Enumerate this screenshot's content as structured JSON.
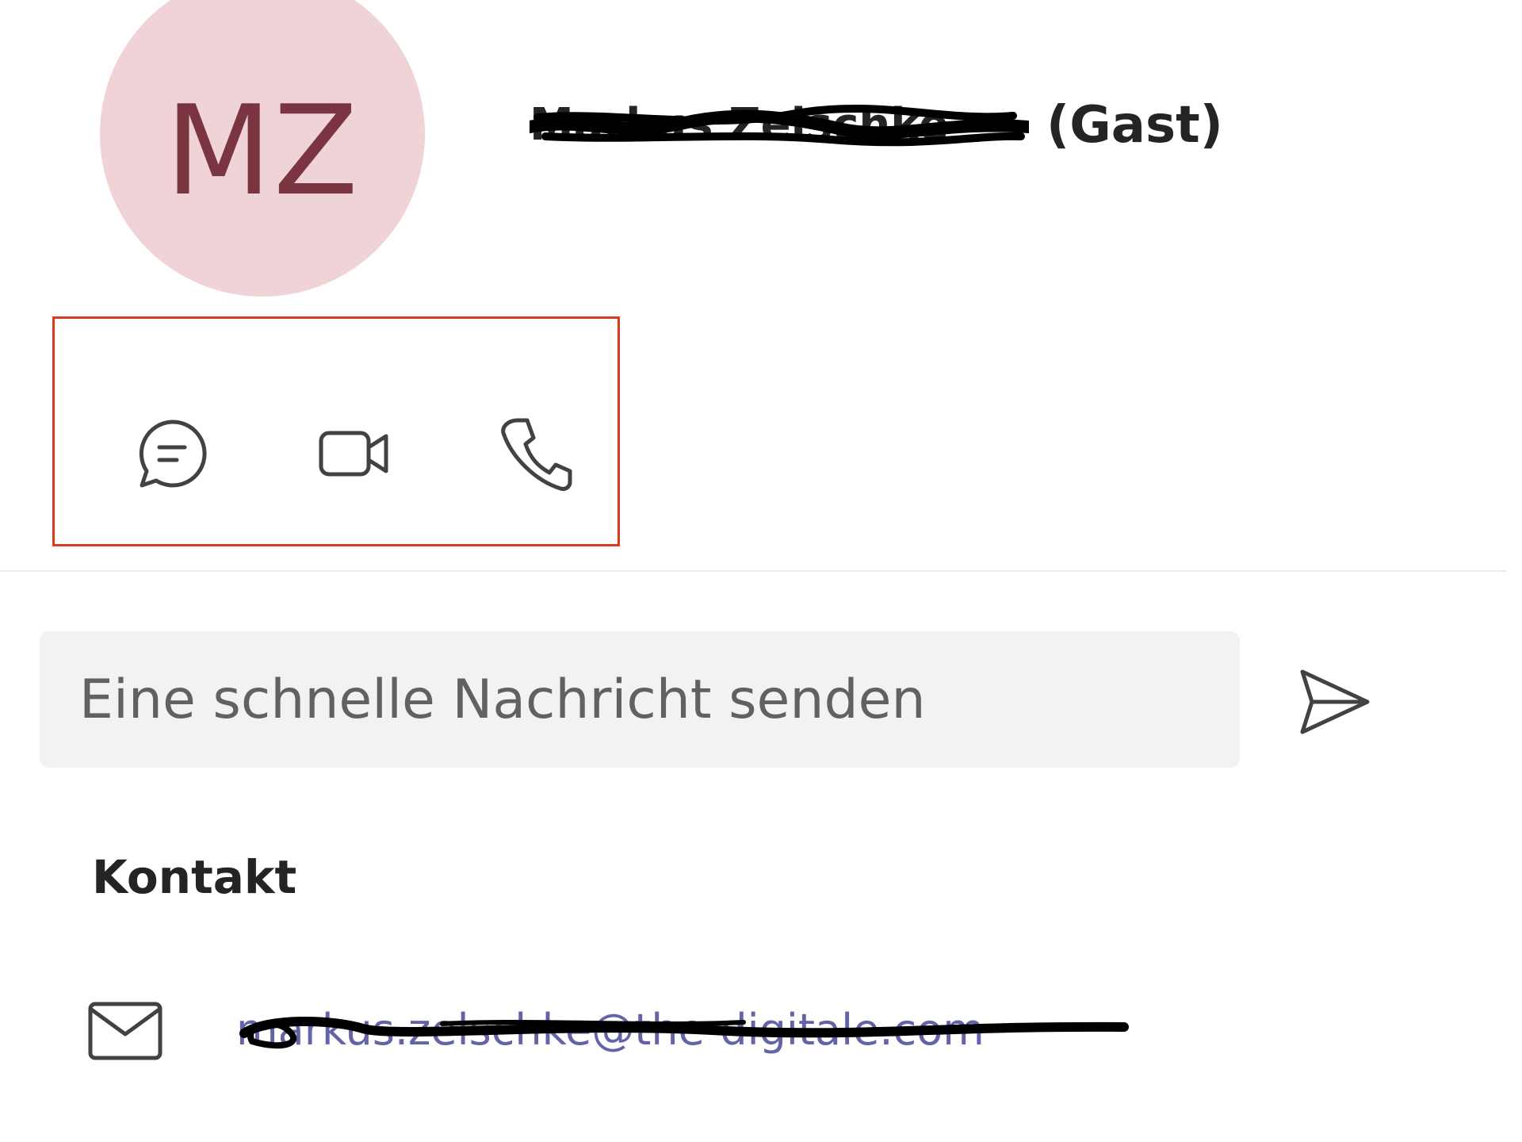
{
  "profile": {
    "initials": "MZ",
    "name": "Markus Zelschke",
    "guest_label": "(Gast)"
  },
  "actions": [
    {
      "icon": "chat-icon",
      "label": "Chat"
    },
    {
      "icon": "video-call-icon",
      "label": "Video call"
    },
    {
      "icon": "phone-icon",
      "label": "Audio call"
    }
  ],
  "quick_message": {
    "placeholder": "Eine schnelle Nachricht senden"
  },
  "contact": {
    "heading": "Kontakt",
    "email": "markus.zelschke@the-digitale.com"
  },
  "colors": {
    "avatar_bg": "#f0d3d6",
    "avatar_text": "#7a3540",
    "highlight_border": "#d63a1f",
    "input_bg": "#f3f2f1",
    "link": "#6264a7"
  }
}
